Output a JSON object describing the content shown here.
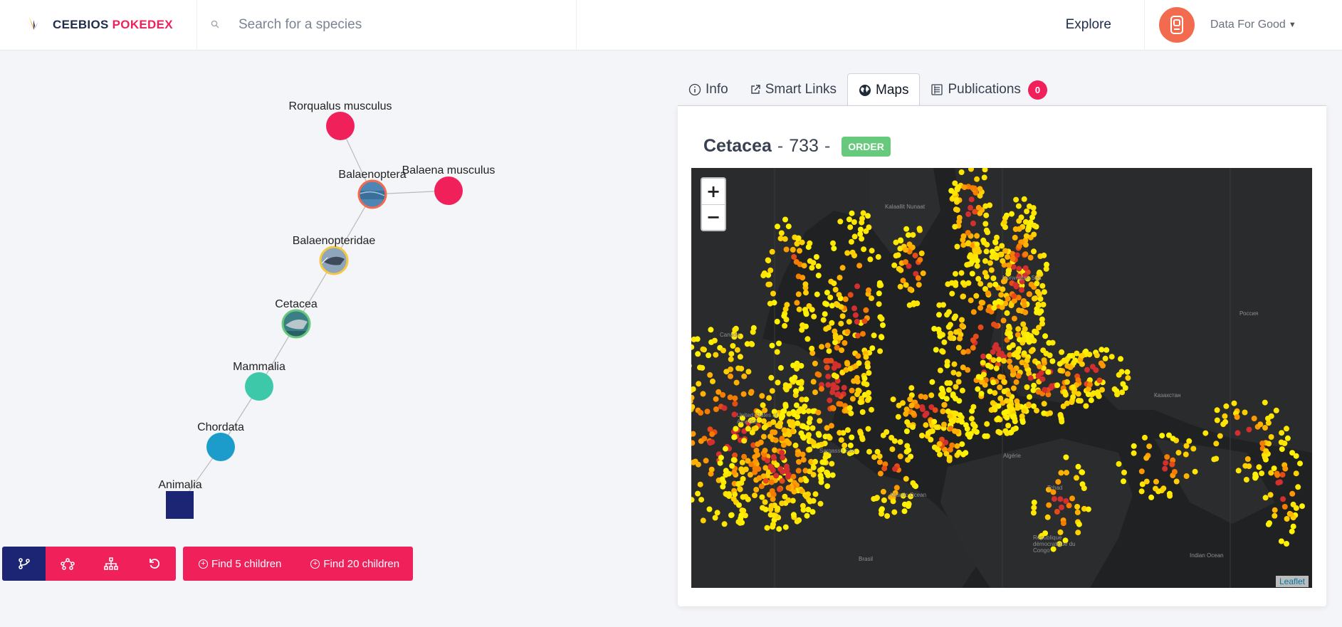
{
  "header": {
    "brand_part1": "CEEBIOS",
    "brand_part2": "POKEDEX",
    "search_placeholder": "Search for a species",
    "explore_label": "Explore",
    "user_name": "Data For Good"
  },
  "tree": {
    "nodes": {
      "rorqualus": "Rorqualus musculus",
      "balaena": "Balaena musculus",
      "balaenoptera": "Balaenoptera",
      "balaenopteridae": "Balaenopteridae",
      "cetacea": "Cetacea",
      "mammalia": "Mammalia",
      "chordata": "Chordata",
      "animalia": "Animalia"
    }
  },
  "toolbar": {
    "find5_label": "Find 5 children",
    "find20_label": "Find 20 children"
  },
  "tabs": {
    "info": "Info",
    "smart_links": "Smart Links",
    "maps": "Maps",
    "publications": "Publications",
    "publications_count": "0"
  },
  "card": {
    "taxon_name": "Cetacea",
    "separator": "-",
    "taxon_id": "733",
    "rank": "ORDER"
  },
  "map": {
    "zoom_in": "+",
    "zoom_out": "−",
    "attribution": "Leaflet",
    "labels": {
      "kalaallit": "Kalaallit Nunaat",
      "norwegian_sea": "Norwegian Sea",
      "canada": "Canada",
      "russia": "Россия",
      "united_states": "United States of America",
      "sargasso": "Sargasso Sea",
      "atlantic": "Atlantic Ocean",
      "indian": "Indian Ocean",
      "algeria": "Algérie",
      "tchad": "Tchad",
      "kazakhstan": "Казахстан",
      "brasil": "Brasil",
      "rdc": "République démocratique du Congo"
    }
  },
  "colors": {
    "accent": "#f0205b",
    "navy": "#1b2574",
    "teal": "#3dc9a9",
    "blue": "#1b9ccb",
    "green_badge": "#67c97b"
  }
}
